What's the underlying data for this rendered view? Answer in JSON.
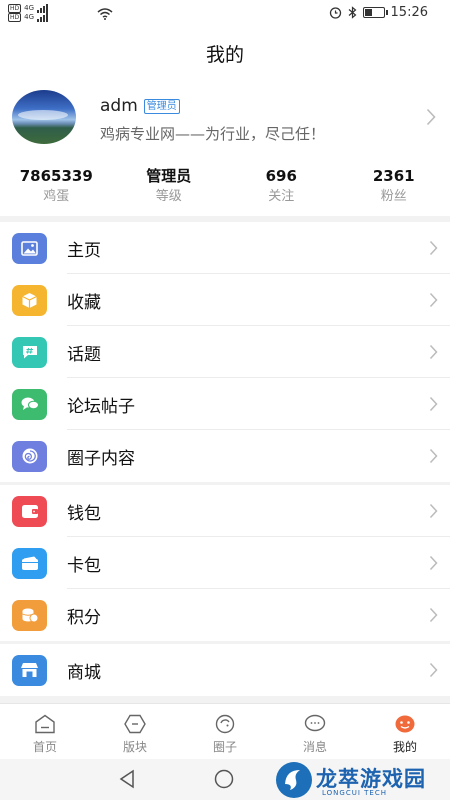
{
  "status_bar": {
    "left_top": "HD",
    "left_bottom": "HD",
    "network_top": "4G",
    "network_bottom": "4G",
    "time": "15:26",
    "battery_level": 0.45,
    "icons": [
      "alarm-icon",
      "bluetooth-icon",
      "battery-icon",
      "wifi-icon",
      "signal-icon"
    ]
  },
  "header": {
    "title": "我的"
  },
  "profile": {
    "username": "adm",
    "role_tag": "管理员",
    "bio": "鸡病专业网——为行业，尽己任！",
    "stats": [
      {
        "value": "7865339",
        "label": "鸡蛋"
      },
      {
        "value": "管理员",
        "label": "等级"
      },
      {
        "value": "696",
        "label": "关注"
      },
      {
        "value": "2361",
        "label": "粉丝"
      }
    ]
  },
  "menu_groups": [
    [
      {
        "label": "主页",
        "icon": "image-icon",
        "color": "#5b7fdc"
      },
      {
        "label": "收藏",
        "icon": "box-icon",
        "color": "#f5b52f"
      },
      {
        "label": "话题",
        "icon": "hashtag-icon",
        "color": "#33c7b4"
      },
      {
        "label": "论坛帖子",
        "icon": "chat-bubbles-icon",
        "color": "#3dbb6e"
      },
      {
        "label": "圈子内容",
        "icon": "circle-swirl-icon",
        "color": "#6f7fe0"
      }
    ],
    [
      {
        "label": "钱包",
        "icon": "wallet-icon",
        "color": "#ef4b55"
      },
      {
        "label": "卡包",
        "icon": "card-icon",
        "color": "#2f9ef0"
      },
      {
        "label": "积分",
        "icon": "coins-icon",
        "color": "#f29d3c"
      }
    ],
    [
      {
        "label": "商城",
        "icon": "store-icon",
        "color": "#3a8be0"
      }
    ]
  ],
  "bottom_nav": [
    {
      "label": "首页",
      "icon": "home-icon",
      "active": false
    },
    {
      "label": "版块",
      "icon": "hexagon-icon",
      "active": false
    },
    {
      "label": "圈子",
      "icon": "circle-icon",
      "active": false
    },
    {
      "label": "消息",
      "icon": "message-icon",
      "active": false
    },
    {
      "label": "我的",
      "icon": "user-icon",
      "active": true
    }
  ],
  "accent_color": "#f06a3c",
  "watermark": {
    "title": "龙萃游戏园",
    "subtitle": "LONGCUI TECH"
  }
}
